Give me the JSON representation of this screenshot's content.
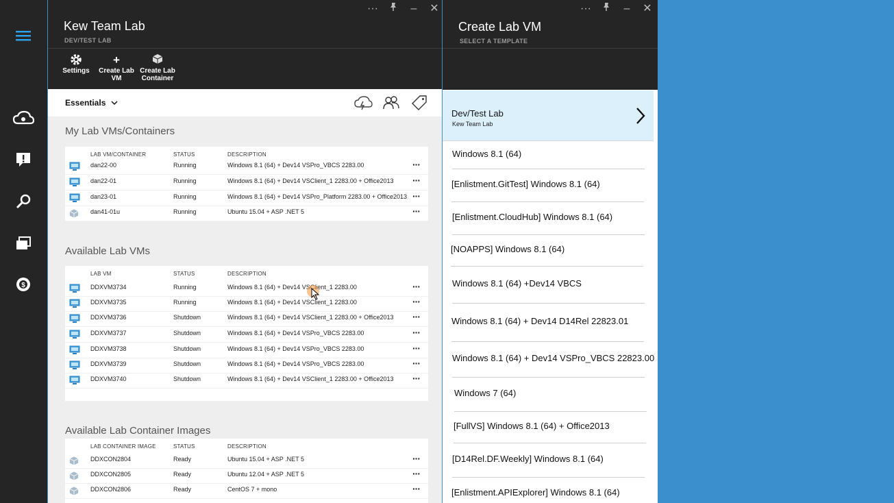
{
  "colors": {
    "accent": "#3a8fcc",
    "dark": "#252525",
    "selected": "#dcf0fb"
  },
  "leftbar": {
    "icons": [
      "hamburger-icon",
      "cloud-icon",
      "alert-icon",
      "search-key-icon",
      "windows-icon",
      "dollar-icon"
    ]
  },
  "blade1": {
    "title": "Kew Team Lab",
    "subtitle": "DEV/TEST LAB",
    "controls": [
      "···",
      "⚲",
      "–",
      "✕"
    ],
    "toolbar": {
      "settings": [
        "Settings"
      ],
      "create_vm": [
        "Create Lab",
        "VM"
      ],
      "create_container": [
        "Create Lab",
        "Container"
      ]
    },
    "essentials_label": "Essentials",
    "my_vms": {
      "title": "My Lab VMs/Containers",
      "columns": [
        "LAB VM/CONTAINER",
        "STATUS",
        "DESCRIPTION"
      ],
      "rows": [
        {
          "name": "dan22-00",
          "status": "Running",
          "desc": "Windows 8.1 (64) + Dev14 VSPro_VBCS 2283.00",
          "icon": "vm"
        },
        {
          "name": "dan22-01",
          "status": "Running",
          "desc": "Windows 8.1 (64) + Dev14 VSClient_1 2283.00 + Office2013",
          "icon": "vm"
        },
        {
          "name": "dan23-01",
          "status": "Running",
          "desc": "Windows 8.1 (64) + Dev14 VSPro_Platform 2283.00 + Office2013",
          "icon": "vm"
        },
        {
          "name": "dan41-01u",
          "status": "Running",
          "desc": "Ubuntu 15.04 + ASP .NET 5",
          "icon": "container"
        }
      ]
    },
    "available_vms": {
      "title": "Available Lab VMs",
      "columns": [
        "LAB VM",
        "STATUS",
        "DESCRIPTION"
      ],
      "rows": [
        {
          "name": "DDXVM3734",
          "status": "Running",
          "desc": "Windows 8.1 (64) + Dev14 VSClient_1 2283.00",
          "icon": "vm"
        },
        {
          "name": "DDXVM3735",
          "status": "Running",
          "desc": "Windows 8.1 (64) + Dev14 VSClient_1 2283.00",
          "icon": "vm"
        },
        {
          "name": "DDXVM3736",
          "status": "Shutdown",
          "desc": "Windows 8.1 (64) + Dev14 VSClient_1 2283.00 + Office2013",
          "icon": "vm"
        },
        {
          "name": "DDXVM3737",
          "status": "Shutdown",
          "desc": "Windows 8.1 (64) + Dev14 VSPro_VBCS 2283.00",
          "icon": "vm"
        },
        {
          "name": "DDXVM3738",
          "status": "Shutdown",
          "desc": "Windows 8.1 (64) + Dev14 VSPro_VBCS 2283.00",
          "icon": "vm"
        },
        {
          "name": "DDXVM3739",
          "status": "Shutdown",
          "desc": "Windows 8.1 (64) + Dev14 VSPro_VBCS 2283.00",
          "icon": "vm"
        },
        {
          "name": "DDXVM3740",
          "status": "Shutdown",
          "desc": "Windows 8.1 (64) + Dev14 VSClient_1 2283.00 + Office2013",
          "icon": "vm"
        }
      ]
    },
    "container_images": {
      "title": "Available Lab Container Images",
      "columns": [
        "LAB CONTAINER IMAGE",
        "STATUS",
        "DESCRIPTION"
      ],
      "rows": [
        {
          "name": "DDXCON2804",
          "status": "Ready",
          "desc": "Ubuntu 15.04 + ASP .NET 5",
          "icon": "container"
        },
        {
          "name": "DDXCON2805",
          "status": "Ready",
          "desc": "Ubuntu 12.04 + ASP .NET 5",
          "icon": "container"
        },
        {
          "name": "DDXCON2806",
          "status": "Ready",
          "desc": "CentOS 7 + mono",
          "icon": "container"
        }
      ]
    }
  },
  "blade2": {
    "title": "Create Lab VM",
    "subtitle": "SELECT A TEMPLATE",
    "controls": [
      "···",
      "⚲",
      "–",
      "✕"
    ],
    "selected": {
      "title": "Dev/Test Lab",
      "subtitle": "Kew Team Lab"
    },
    "templates": [
      "Windows 8.1 (64)",
      "[Enlistment.GitTest] Windows 8.1 (64)",
      "[Enlistment.CloudHub] Windows 8.1 (64)",
      "[NOAPPS] Windows 8.1 (64)",
      "Windows 8.1 (64) +Dev14 VBCS",
      "Windows 8.1 (64) + Dev14 D14Rel 22823.01",
      "Windows 8.1 (64) + Dev14 VSPro_VBCS 22823.00",
      "Windows 7 (64)",
      "[FullVS] Windows 8.1 (64) + Office2013",
      "[D14Rel.DF.Weekly] Windows 8.1 (64)",
      "[Enlistment.APIExplorer] Windows 8.1 (64)"
    ]
  }
}
